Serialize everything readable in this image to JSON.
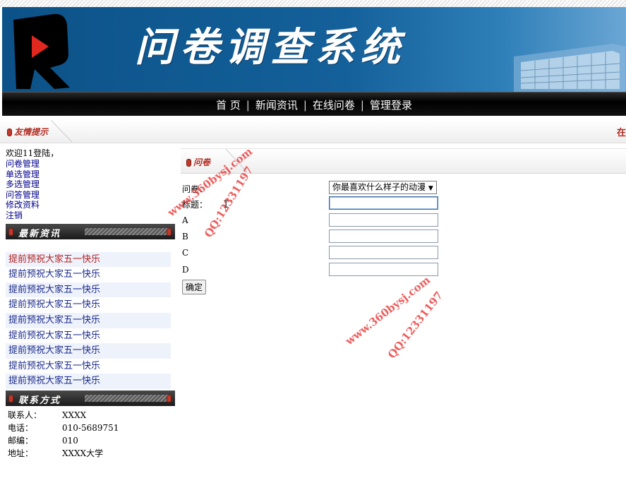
{
  "site": {
    "title": "问卷调查系统"
  },
  "nav": {
    "items": [
      "首 页",
      "新闻资讯",
      "在线问卷",
      "管理登录"
    ],
    "separator": "|"
  },
  "notice": {
    "title": "友情提示",
    "scroll_text": "在"
  },
  "sidebar": {
    "welcome": "欢迎11登陆，",
    "links": [
      "问卷管理",
      "单选管理",
      "多选管理",
      "问答管理",
      "修改资料",
      "注销"
    ],
    "news_header": "最新资讯",
    "news": [
      "提前预祝大家五一快乐",
      "提前预祝大家五一快乐",
      "提前预祝大家五一快乐",
      "提前预祝大家五一快乐",
      "提前预祝大家五一快乐",
      "提前预祝大家五一快乐",
      "提前预祝大家五一快乐",
      "提前预祝大家五一快乐",
      "提前预祝大家五一快乐"
    ],
    "contact_header": "联系方式",
    "contact": [
      {
        "k": "联系人：",
        "v": "XXXX"
      },
      {
        "k": "电话：",
        "v": "010-5689751"
      },
      {
        "k": "邮编：",
        "v": "010"
      },
      {
        "k": "地址：",
        "v": "XXXX大学"
      }
    ]
  },
  "main": {
    "title": "问卷",
    "form": {
      "questionnaire_label": "问卷：",
      "questionnaire_selected": "你最喜欢什么样子的动漫",
      "title_label": "标题：",
      "title_value": "",
      "option_a_label": "A",
      "option_a_value": "",
      "option_b_label": "B",
      "option_b_value": "",
      "option_c_label": "C",
      "option_c_value": "",
      "option_d_label": "D",
      "option_d_value": "",
      "submit_label": "确定"
    }
  },
  "watermarks": [
    "www.360bysj.com",
    "QQ:12331197",
    "www.360bysj.com",
    "QQ:12331197"
  ],
  "colors": {
    "banner": "#14609a",
    "accent_red": "#b02a20",
    "link": "#00008b",
    "news_link": "#1a2a8c"
  }
}
